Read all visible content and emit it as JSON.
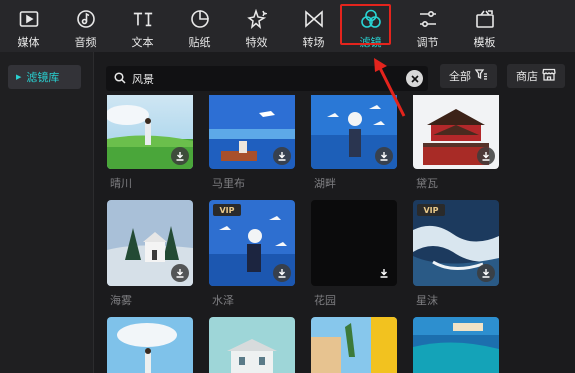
{
  "toolbar": {
    "tools": [
      {
        "label": "媒体",
        "icon": "play-box-icon"
      },
      {
        "label": "音频",
        "icon": "music-note-icon"
      },
      {
        "label": "文本",
        "icon": "text-icon"
      },
      {
        "label": "贴纸",
        "icon": "sticker-icon"
      },
      {
        "label": "特效",
        "icon": "sparkle-star-icon"
      },
      {
        "label": "转场",
        "icon": "transition-icon"
      },
      {
        "label": "滤镜",
        "icon": "filter-circles-icon",
        "active": true
      },
      {
        "label": "调节",
        "icon": "sliders-icon"
      },
      {
        "label": "模板",
        "icon": "template-icon"
      }
    ]
  },
  "sidebar": {
    "items": [
      {
        "label": "滤镜库"
      }
    ]
  },
  "search": {
    "value": "风景"
  },
  "filters_bar": {
    "all_label": "全部",
    "store_label": "商店"
  },
  "grid": {
    "items": [
      {
        "label": "晴川",
        "vip": false
      },
      {
        "label": "马里布",
        "vip": false
      },
      {
        "label": "湖畔",
        "vip": false
      },
      {
        "label": "黛瓦",
        "vip": false
      },
      {
        "label": "海雾",
        "vip": false
      },
      {
        "label": "水泽",
        "vip": true,
        "badge": "VIP"
      },
      {
        "label": "花园",
        "vip": false
      },
      {
        "label": "星沫",
        "vip": true,
        "badge": "VIP"
      },
      {
        "label": "",
        "vip": false
      },
      {
        "label": "",
        "vip": false
      },
      {
        "label": "",
        "vip": false
      },
      {
        "label": "",
        "vip": false
      }
    ]
  },
  "colors": {
    "accent": "#29d3d3",
    "annotation": "#e4241d",
    "background": "#1b1b1d"
  }
}
